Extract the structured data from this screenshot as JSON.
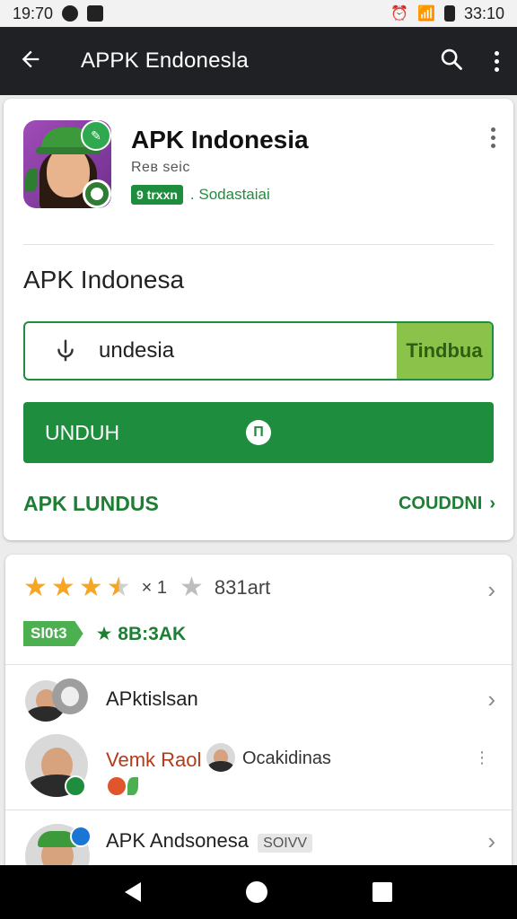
{
  "status_bar": {
    "time": "19:70",
    "clock_right": "33:10"
  },
  "app_bar": {
    "title": "APPK Endonesla"
  },
  "app_card": {
    "name": "APK Indonesia",
    "developer": "Reв seic",
    "tag": "9 trxxn",
    "category": ". Sodastaiai",
    "section_title": "APK Indonesa",
    "input_value": "undesia",
    "input_button": "Tindbua",
    "download_label": "UNDUH",
    "download_icon": "Π",
    "link_left": "APK LUNDUS",
    "link_right": "COUDDNI"
  },
  "review_card": {
    "rating_count": "× 1",
    "rating_total": "831art",
    "badge": "Sl0t3",
    "rating_value": "★ 8B:3AK",
    "row1_title": "APktislsan",
    "row2_title": "Vemk Raol",
    "row2_sub": "Ocakidinas",
    "row3_title": "APK Andsonesa",
    "row3_tag": "SOIVV"
  },
  "colors": {
    "primary_green": "#1e8e3e",
    "light_green": "#8bc34a",
    "star": "#f5a623",
    "appbar": "#202124"
  },
  "icons": [
    "back-arrow-icon",
    "search-icon",
    "more-vert-icon",
    "mic-icon",
    "download-icon",
    "chevron-right-icon",
    "star-icon",
    "nav-back-icon",
    "nav-home-icon",
    "nav-recents-icon"
  ]
}
